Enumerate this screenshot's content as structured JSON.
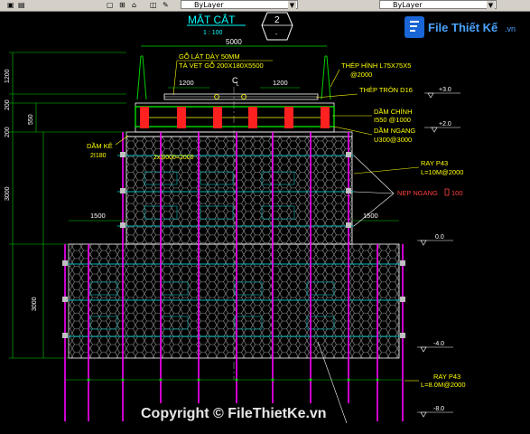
{
  "toolbar": {
    "layer_combo_1": "ByLayer",
    "layer_combo_2": "ByLayer"
  },
  "logo": {
    "text": "File Thiết Kế",
    "domain": ".vn"
  },
  "drawing": {
    "title": "MẶT CẮT",
    "scale": "1 : 100",
    "section_mark": "2",
    "section_mark_sub": "-",
    "dims": {
      "total_width": "5000",
      "left_1200": "1200",
      "right_1200": "1200",
      "h1200": "1200",
      "h200a": "200",
      "h200b": "200",
      "h550": "550",
      "h3000a": "3000",
      "h3000b": "3000",
      "w1500l": "1500",
      "w1500r": "1500"
    },
    "labels": {
      "go_lat": "GỖ LÁT DÀY 50MM",
      "ta_vet": "TÀ VẸT GỖ 200X180X5500",
      "thep_hinh": "THÉP HÌNH L75X75X5",
      "thep_hinh_at": "@2000",
      "thep_tron": "THÉP TRÒN D16",
      "dam_chinh": "DẦM CHÍNH",
      "dam_chinh_spec": "I550 @1000",
      "dam_ngang": "DẦM NGANG",
      "dam_ngang_spec": "U300@3000",
      "dam_ke": "DẦM KÊ",
      "dam_ke_spec": "2I180",
      "dam_ke_note": "2x3I000=2000",
      "ray_p43_top": "RAY P43",
      "ray_p43_top_spec": "L=10M@2000",
      "nep_ngang": "NẸP NGANG",
      "nep_ngang_spec": "100",
      "ray_p43_bot": "RAY P43",
      "ray_p43_bot_spec": "L=8.0M@2000",
      "center": "C",
      "center_sub": "L"
    },
    "levels": {
      "lv_p30": "+3.0",
      "lv_p20": "+2.0",
      "lv_00": "0.0",
      "lv_m40": "-4.0",
      "lv_m80": "-8.0"
    }
  },
  "watermark": "Copyright © FileThietKe.vn",
  "colors": {
    "background": "#000000",
    "hex_mesh": "#9a9a9a",
    "pile": "#ff00ff",
    "brace": "#00b4b4",
    "text_yellow": "#ffff00",
    "dim_green": "#00d000",
    "beam_red": "#ff2020"
  }
}
